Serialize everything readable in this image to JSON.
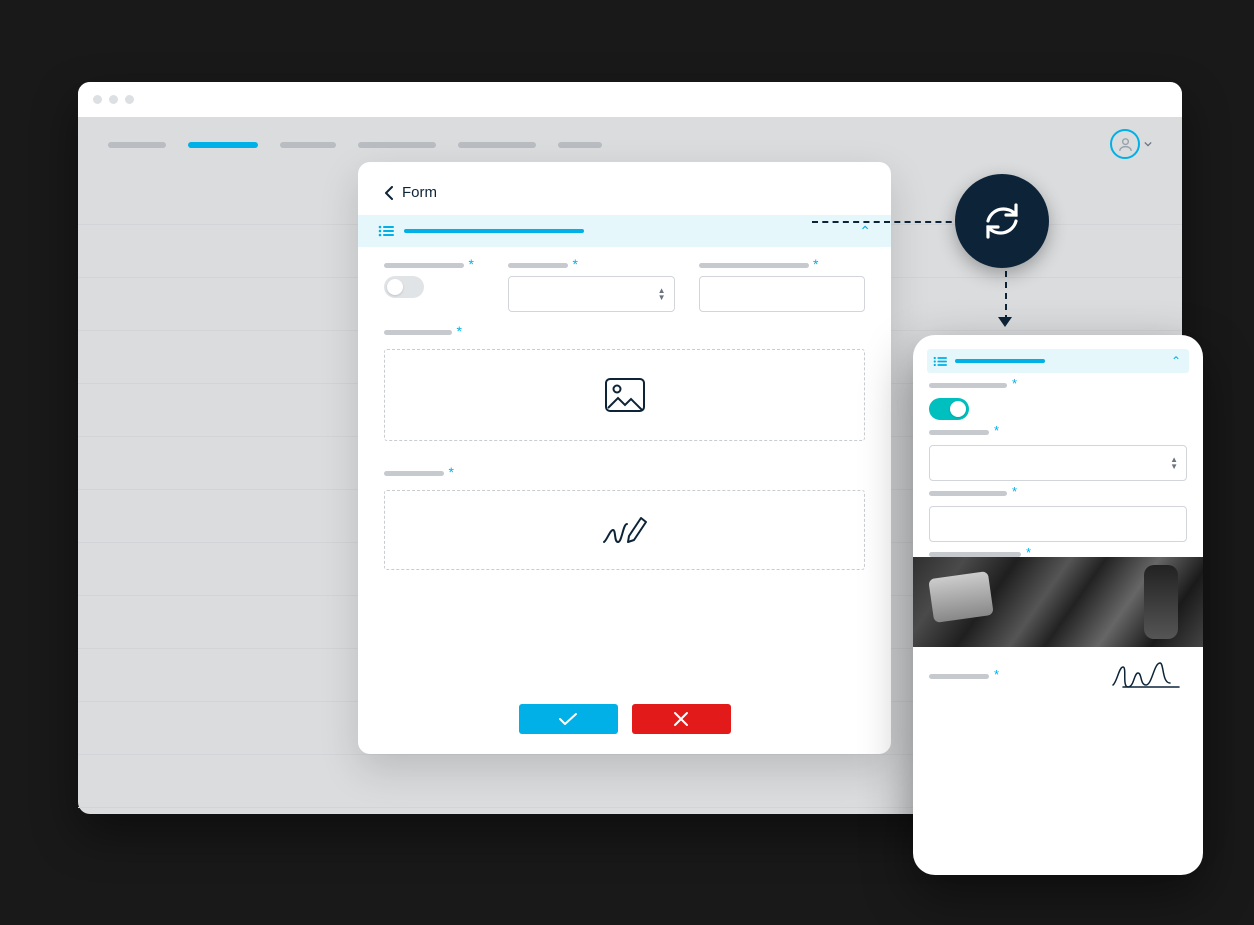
{
  "browser": {
    "nav_items_count": 6,
    "active_nav_index": 1
  },
  "modal": {
    "title": "Form",
    "required_marker": "*",
    "toggle_on": false
  },
  "phone": {
    "toggle_on": true
  },
  "colors": {
    "accent": "#00b0e6",
    "dark": "#0d2438",
    "danger": "#e21a1a",
    "teal": "#00bfbf"
  }
}
